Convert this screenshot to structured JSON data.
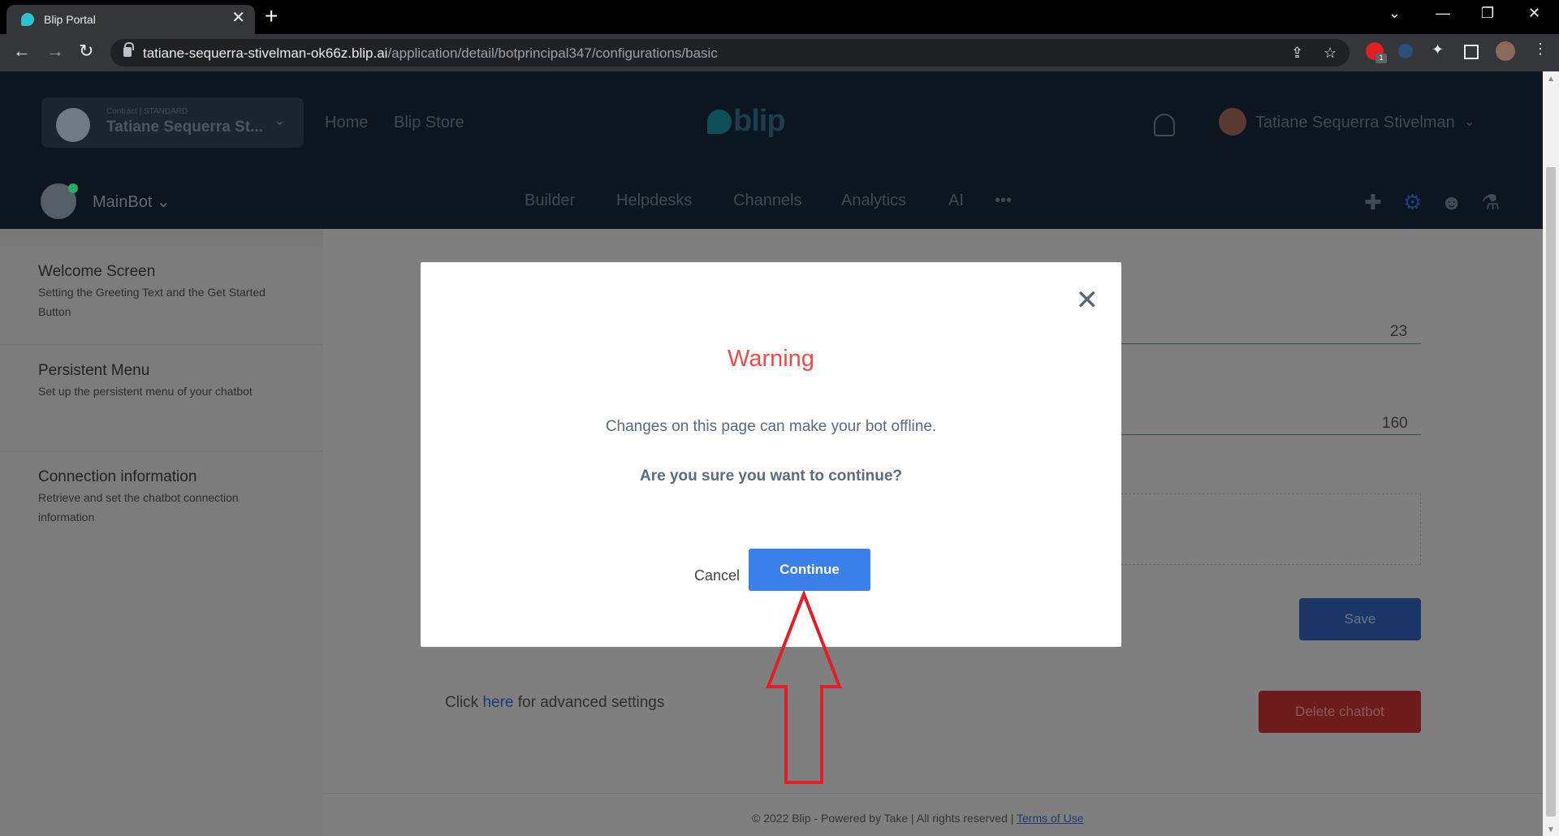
{
  "browser": {
    "tab_title": "Blip Portal",
    "tab_close": "✕",
    "new_tab": "+",
    "url_host": "tatiane-sequerra-stivelman-ok66z.blip.ai",
    "url_path": "/application/detail/botprincipal347/configurations/basic",
    "extension_badge": "1"
  },
  "header": {
    "contract_label": "Contract | STANDARD",
    "contract_name": "Tatiane Sequerra St...",
    "nav_home": "Home",
    "nav_store": "Blip Store",
    "logo_text": "blip",
    "user_name": "Tatiane Sequerra Stivelman"
  },
  "bot_bar": {
    "bot_name": "MainBot",
    "nav": [
      "Builder",
      "Helpdesks",
      "Channels",
      "Analytics",
      "AI"
    ],
    "more": "•••"
  },
  "sidebar": {
    "items": [
      {
        "title": "Welcome Screen",
        "desc": "Setting the Greeting Text and the Get Started Button"
      },
      {
        "title": "Persistent Menu",
        "desc": "Set up the persistent menu of your chatbot"
      },
      {
        "title": "Connection information",
        "desc": "Retrieve and set the chatbot connection information"
      }
    ]
  },
  "main": {
    "field1_value": "23",
    "field2_value": "160",
    "save_label": "Save",
    "delete_label": "Delete chatbot",
    "advanced_prefix": "Click ",
    "advanced_link": "here",
    "advanced_suffix": " for advanced settings",
    "footer_text": "© 2022 Blip - Powered by Take | All rights reserved | ",
    "footer_terms": "Terms of Use"
  },
  "modal": {
    "title": "Warning",
    "message": "Changes on this page can make your bot offline.",
    "question": "Are you sure you want to continue?",
    "cancel_label": "Cancel",
    "continue_label": "Continue"
  },
  "colors": {
    "warning": "#f04b4b",
    "primary": "#3b7fe8",
    "annotation_arrow": "#e41e26"
  }
}
